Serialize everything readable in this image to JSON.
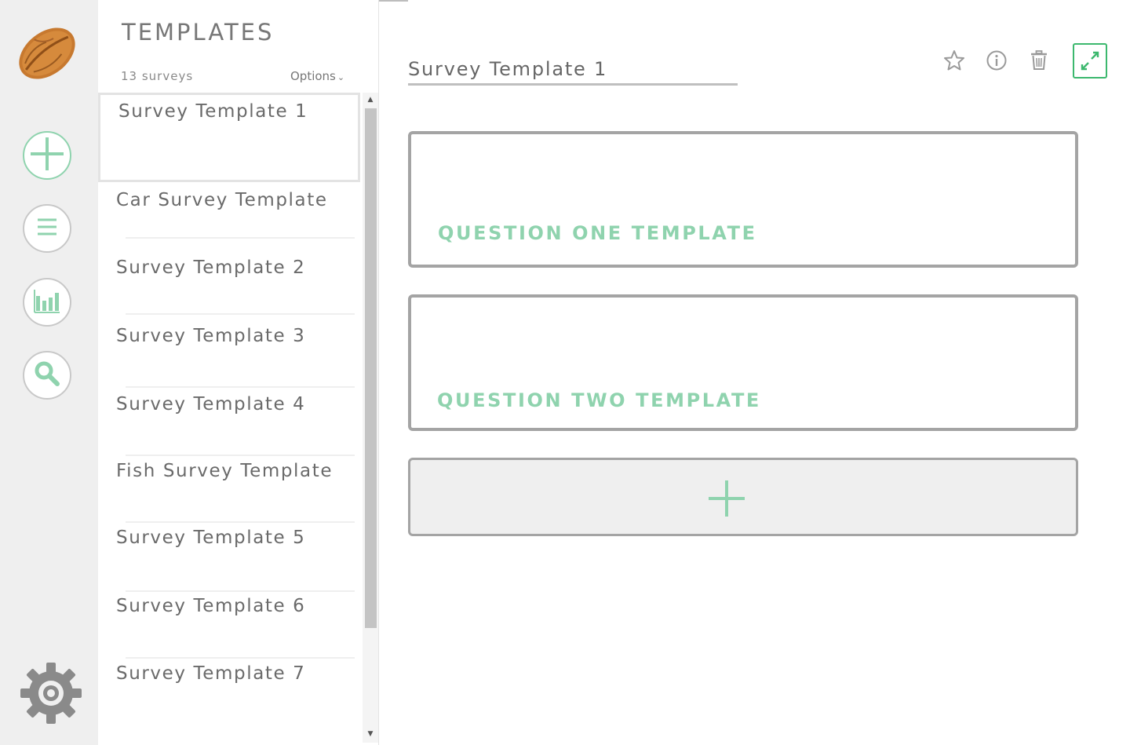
{
  "colors": {
    "accent": "#8fd3ae",
    "accent_strong": "#3cb86e",
    "rail_bg": "#efefef",
    "card_border": "#a4a4a4"
  },
  "rail": {
    "logo": "pecan-logo",
    "buttons": [
      "add-icon",
      "list-icon",
      "bar-chart-icon",
      "search-icon"
    ],
    "settings": "gear-icon"
  },
  "panel": {
    "title": "TEMPLATES",
    "count": "13 surveys",
    "options_label": "Options",
    "items": [
      {
        "label": "Survey Template 1"
      },
      {
        "label": "Car Survey Template"
      },
      {
        "label": "Survey Template 2"
      },
      {
        "label": "Survey Template 3"
      },
      {
        "label": "Survey Template 4"
      },
      {
        "label": "Fish Survey Template"
      },
      {
        "label": "Survey Template 5"
      },
      {
        "label": "Survey Template 6"
      },
      {
        "label": "Survey Template 7"
      }
    ]
  },
  "main": {
    "survey_title": "Survey Template 1",
    "toolbar": [
      "star-icon",
      "info-icon",
      "trash-icon",
      "expand-icon"
    ],
    "questions": [
      {
        "label": "QUESTION ONE TEMPLATE"
      },
      {
        "label": "QUESTION TWO TEMPLATE"
      }
    ],
    "add_question": "plus-icon"
  }
}
